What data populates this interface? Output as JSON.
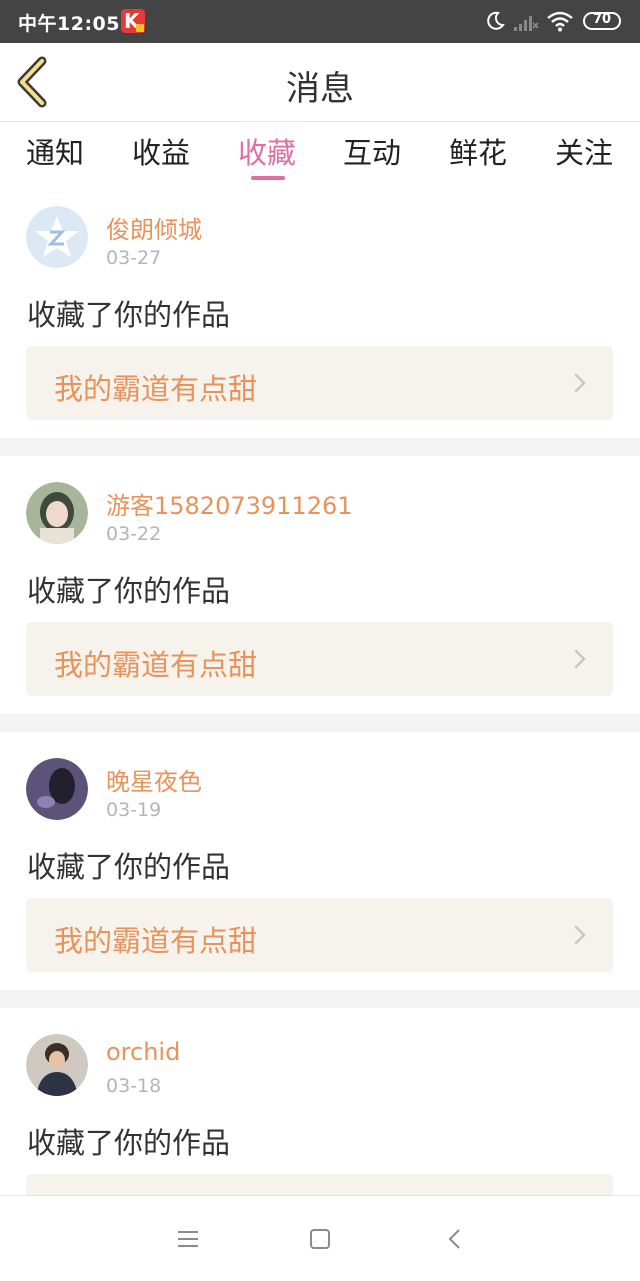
{
  "status_bar": {
    "time": "中午12:05",
    "app_badge": "K",
    "battery": "70",
    "icons": [
      "moon-icon",
      "signal-icon",
      "wifi-icon",
      "battery-icon"
    ]
  },
  "header": {
    "title": "消息",
    "back_icon": "chevron-left-icon"
  },
  "tabs": [
    {
      "label": "通知",
      "active": false
    },
    {
      "label": "收益",
      "active": false
    },
    {
      "label": "收藏",
      "active": true
    },
    {
      "label": "互动",
      "active": false
    },
    {
      "label": "鲜花",
      "active": false
    },
    {
      "label": "关注",
      "active": false
    }
  ],
  "items": [
    {
      "username": "俊朗倾城",
      "date": "03-27",
      "action": "收藏了你的作品",
      "work": "我的霸道有点甜"
    },
    {
      "username": "游客1582073911261",
      "date": "03-22",
      "action": "收藏了你的作品",
      "work": "我的霸道有点甜"
    },
    {
      "username": "晚星夜色",
      "date": "03-19",
      "action": "收藏了你的作品",
      "work": "我的霸道有点甜"
    },
    {
      "username": "orchid",
      "date": "03-18",
      "action": "收藏了你的作品",
      "work": ""
    }
  ],
  "nav": {
    "icons": [
      "menu-icon",
      "home-square-icon",
      "back-triangle-icon"
    ]
  },
  "colors": {
    "accent_pink": "#e26da3",
    "username_orange": "#e8935b",
    "work_box_bg": "#f5f3ec",
    "status_bar_bg": "#444444"
  }
}
